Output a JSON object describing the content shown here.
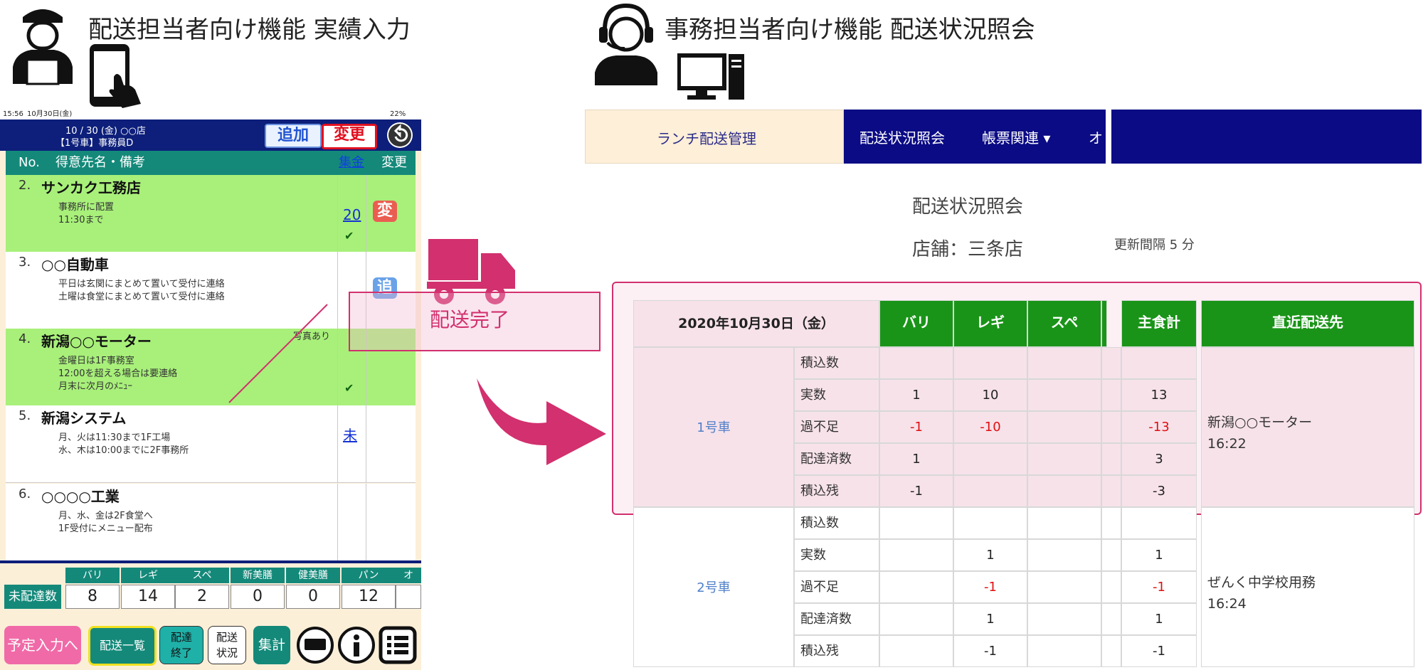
{
  "left_header": {
    "title": "配送担当者向け機能 実績入力"
  },
  "right_header": {
    "title": "事務担当者向け機能 配送状況照会"
  },
  "tablet": {
    "status": {
      "time": "15:56",
      "date": "10月30日(金)",
      "battery": "22%"
    },
    "header": {
      "line1": "10 / 30 (金) ○○店",
      "line2": "【1号車】事務員D",
      "add": "追加",
      "change": "変更"
    },
    "columns": {
      "no": "No.",
      "name": "得意先名・備考",
      "collect": "集金",
      "change": "変更"
    },
    "rows": [
      {
        "no": "2.",
        "name": "サンカク工務店",
        "notes": [
          "事務所に配置",
          "11:30まで"
        ],
        "amount": "20",
        "badge": "変"
      },
      {
        "no": "3.",
        "name": "○○自動車",
        "notes": [
          "平日は玄関にまとめて置いて受付に連絡",
          "土曜は食堂にまとめて置いて受付に連絡"
        ],
        "badge": "追"
      },
      {
        "no": "4.",
        "name": "新潟○○モーター",
        "notes": [
          "金曜日は1F事務室",
          "12:00を超える場合は要連絡",
          "月末に次月のﾒﾆｭｰ"
        ],
        "photo": "写真あり"
      },
      {
        "no": "5.",
        "name": "新潟システム",
        "notes": [
          "月、火は11:30まで1F工場",
          "水、木は10:00までに2F事務所"
        ],
        "amount": "未"
      },
      {
        "no": "6.",
        "name": "○○○○工業",
        "notes": [
          "月、水、金は2F食堂へ",
          "1F受付にメニュー配布"
        ]
      }
    ],
    "summary": {
      "label": "未配達数",
      "headers": [
        "バリ",
        "レギ",
        "スペ",
        "新美膳",
        "健美膳",
        "パン",
        "オ"
      ],
      "values": [
        "8",
        "14",
        "2",
        "0",
        "0",
        "12"
      ]
    },
    "buttons": {
      "plan": "予定入力へ",
      "list": "配送一覧",
      "end_1": "配達",
      "end_2": "終了",
      "status_1": "配送",
      "status_2": "状況",
      "total": "集計"
    }
  },
  "overlay": {
    "label": "配送完了"
  },
  "web": {
    "brand": "ランチ配送管理",
    "nav": [
      "配送状況照会",
      "帳票関連 ▾",
      "オ"
    ],
    "page_title": "配送状況照会",
    "store": "店舗：三条店",
    "refresh": "更新間隔 5 分",
    "table": {
      "date": "2020年10月30日（金）",
      "columns": [
        "バリ",
        "レギ",
        "スペ",
        "主食計",
        "直近配送先"
      ],
      "row_labels": [
        "積込数",
        "実数",
        "過不足",
        "配達済数",
        "積込残"
      ],
      "vehicles": [
        {
          "name": "1号車",
          "rows": [
            [
              "",
              "",
              "",
              ""
            ],
            [
              "1",
              "10",
              "",
              "13"
            ],
            [
              "-1",
              "-10",
              "",
              "-13"
            ],
            [
              "1",
              "",
              "",
              "3"
            ],
            [
              "-1",
              "",
              "",
              "-3"
            ]
          ],
          "latest": "新潟○○モーター",
          "latest_time": "16:22"
        },
        {
          "name": "2号車",
          "rows": [
            [
              "",
              "",
              "",
              ""
            ],
            [
              "",
              "1",
              "",
              "1"
            ],
            [
              "",
              "-1",
              "",
              "-1"
            ],
            [
              "",
              "1",
              "",
              "1"
            ],
            [
              "",
              "-1",
              "",
              "-1"
            ]
          ],
          "latest": "ぜんく中学校用務",
          "latest_time": "16:24"
        }
      ]
    }
  },
  "colors": {
    "navy": "#0d1f7a",
    "teal": "#14897a",
    "green": "#1a9418",
    "pink": "#d2306e",
    "row_green": "#a8f07a"
  }
}
